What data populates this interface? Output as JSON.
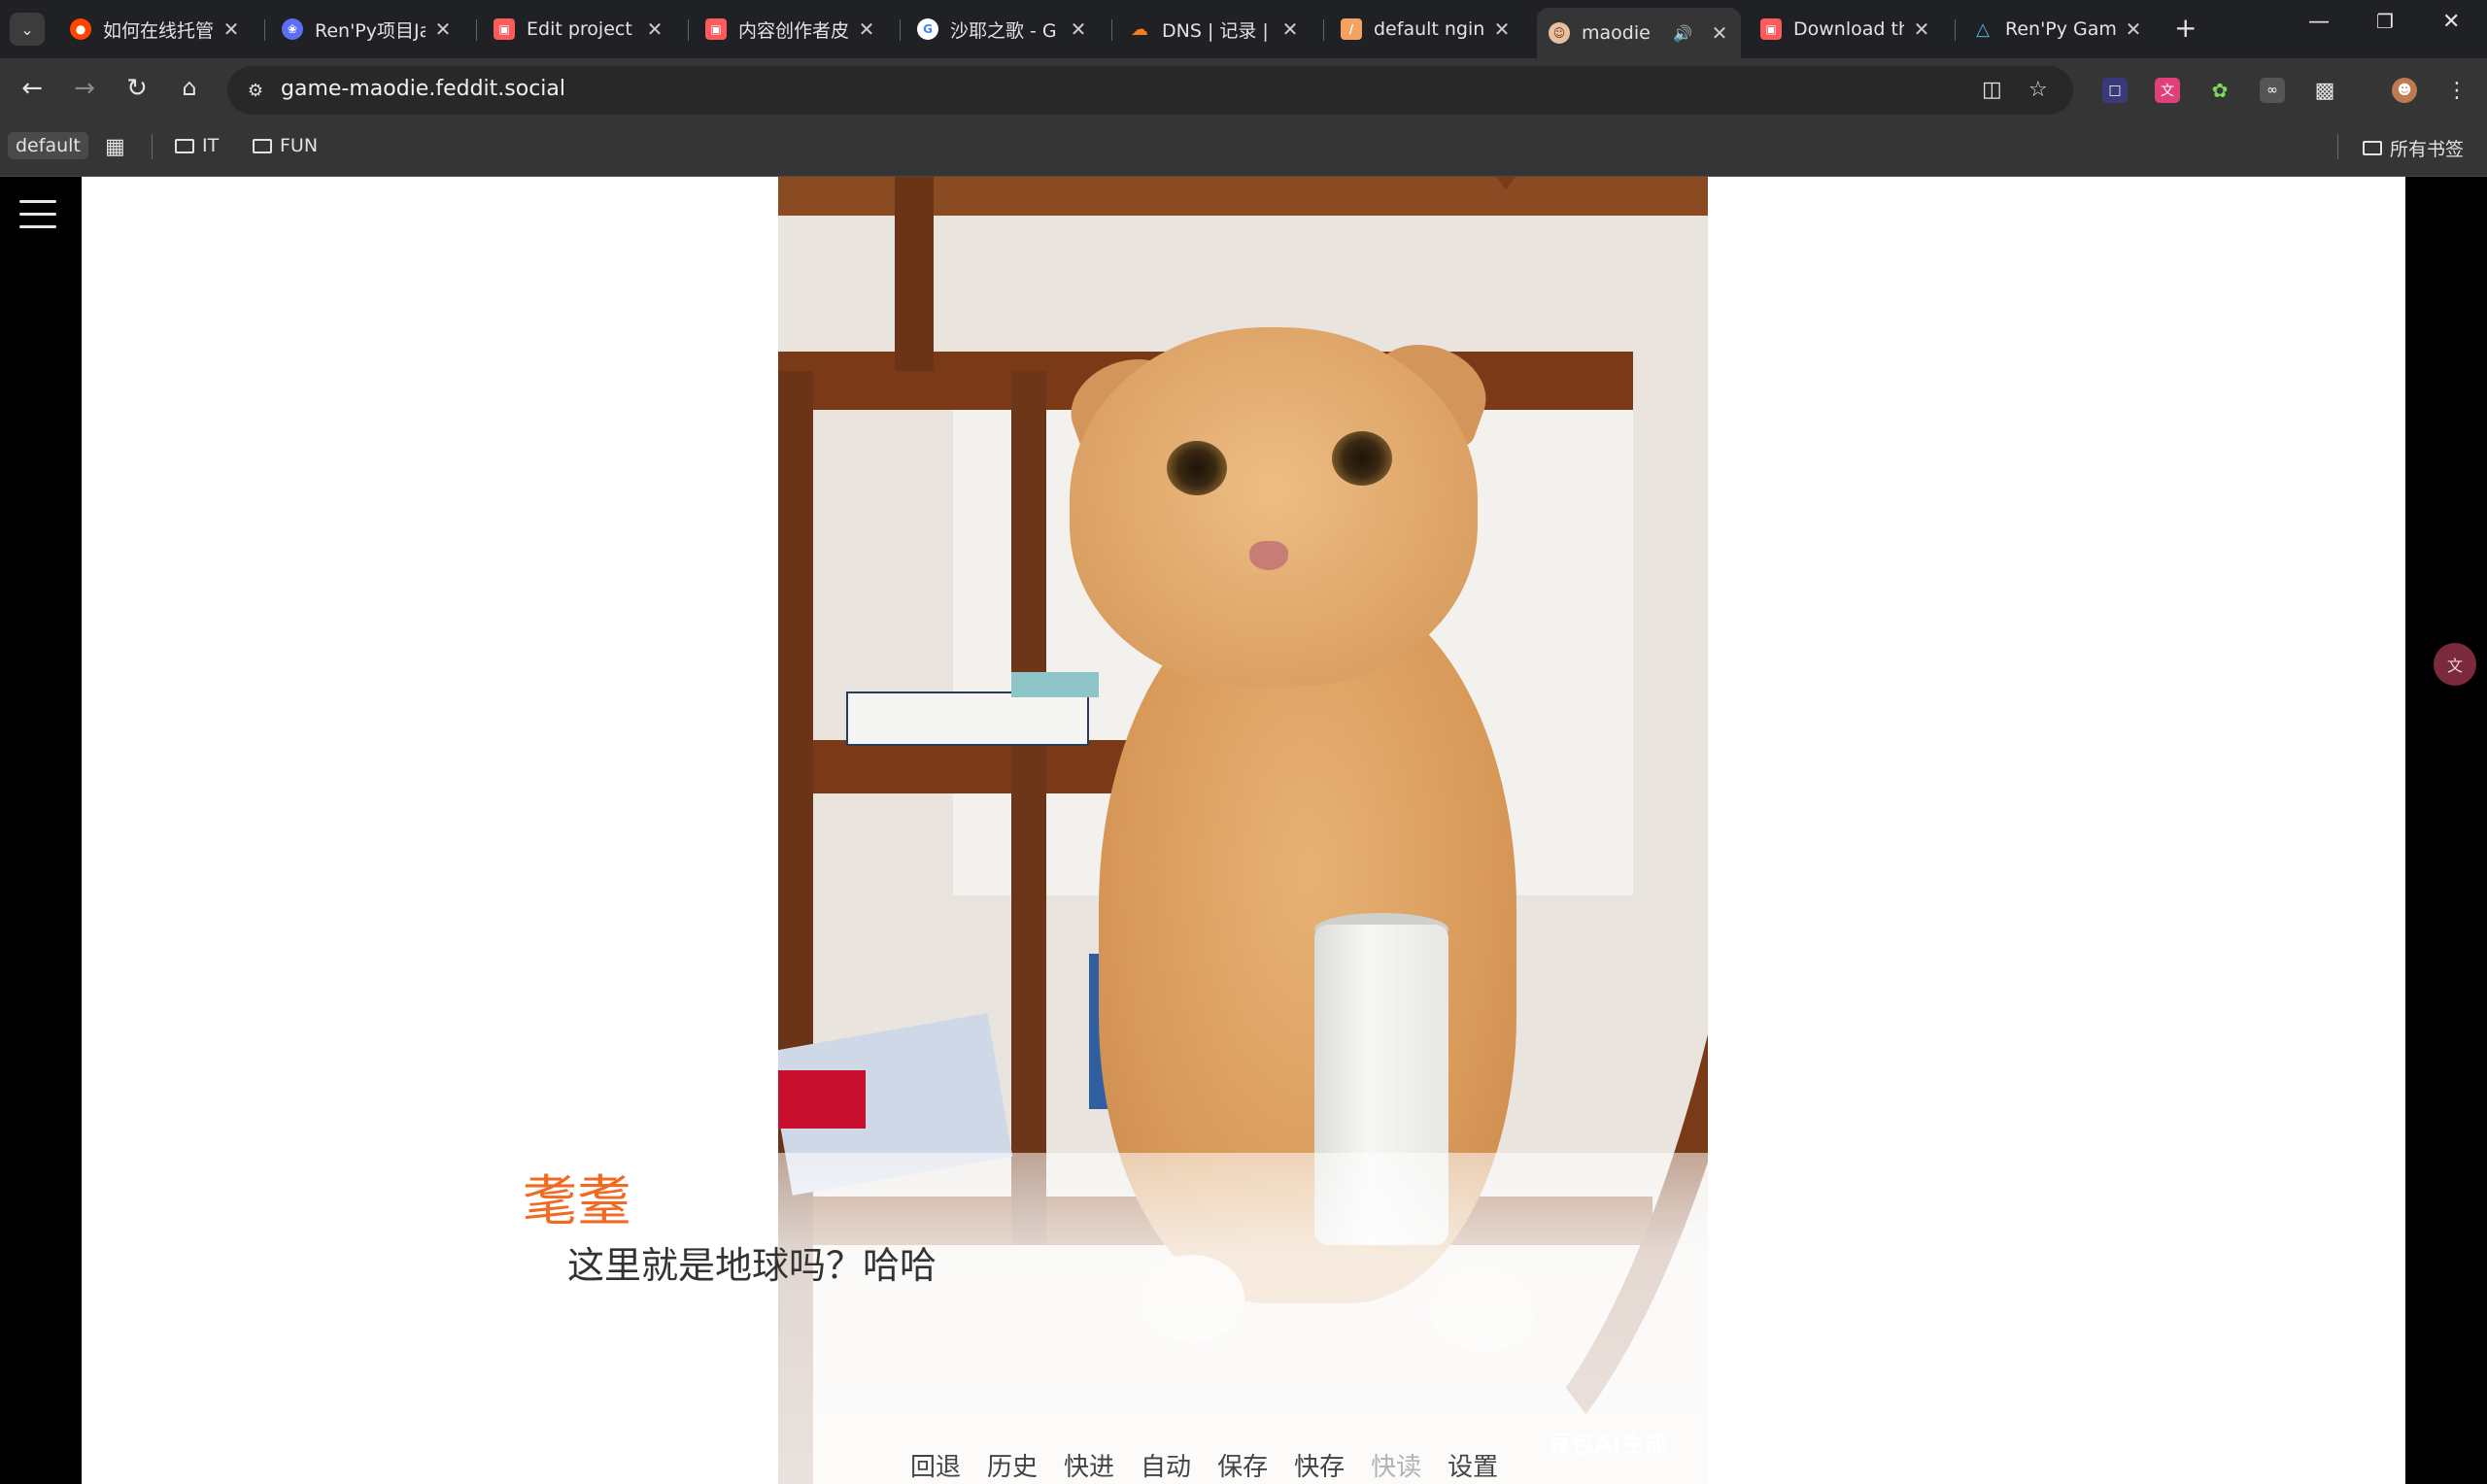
{
  "tabs": [
    {
      "title": "如何在线托管",
      "favicon": "reddit-icon",
      "color": "#ff4500"
    },
    {
      "title": "Ren'Py项目Ja",
      "favicon": "renpy-butterfly-icon",
      "color": "#5b6ef5"
    },
    {
      "title": "Edit project",
      "favicon": "itchio-icon",
      "color": "#fa5c5c"
    },
    {
      "title": "内容创作者皮",
      "favicon": "itchio-icon",
      "color": "#fa5c5c"
    },
    {
      "title": "沙耶之歌 - G",
      "favicon": "google-icon",
      "color": "#4285f4"
    },
    {
      "title": "DNS | 记录 | ",
      "favicon": "cloudflare-icon",
      "color": "#f38020"
    },
    {
      "title": "default ngin",
      "favicon": "nginx-file-icon",
      "color": "#f4a261"
    },
    {
      "title": "maodie",
      "favicon": "maodie-icon",
      "color": "#e8c0a0",
      "active": true
    },
    {
      "title": "Download th",
      "favicon": "itchio-icon",
      "color": "#fa5c5c"
    },
    {
      "title": "Ren'Py Gam",
      "favicon": "renpy-triangle-icon",
      "color": "#4fb3d9"
    }
  ],
  "address_bar": {
    "url": "game-maodie.feddit.social"
  },
  "bookmarks": {
    "profile_chip": "default",
    "folders": [
      "IT",
      "FUN"
    ],
    "all_bookmarks": "所有书签"
  },
  "game": {
    "speaker": "耄耋",
    "dialogue": "这里就是地球吗？哈哈",
    "watermark": "豆包AI生成",
    "speaker_color": "#f06a24",
    "quick_menu": [
      {
        "label": "回退",
        "enabled": true
      },
      {
        "label": "历史",
        "enabled": true
      },
      {
        "label": "快进",
        "enabled": true
      },
      {
        "label": "自动",
        "enabled": true
      },
      {
        "label": "保存",
        "enabled": true
      },
      {
        "label": "快存",
        "enabled": true
      },
      {
        "label": "快读",
        "enabled": false
      },
      {
        "label": "设置",
        "enabled": true
      }
    ]
  }
}
